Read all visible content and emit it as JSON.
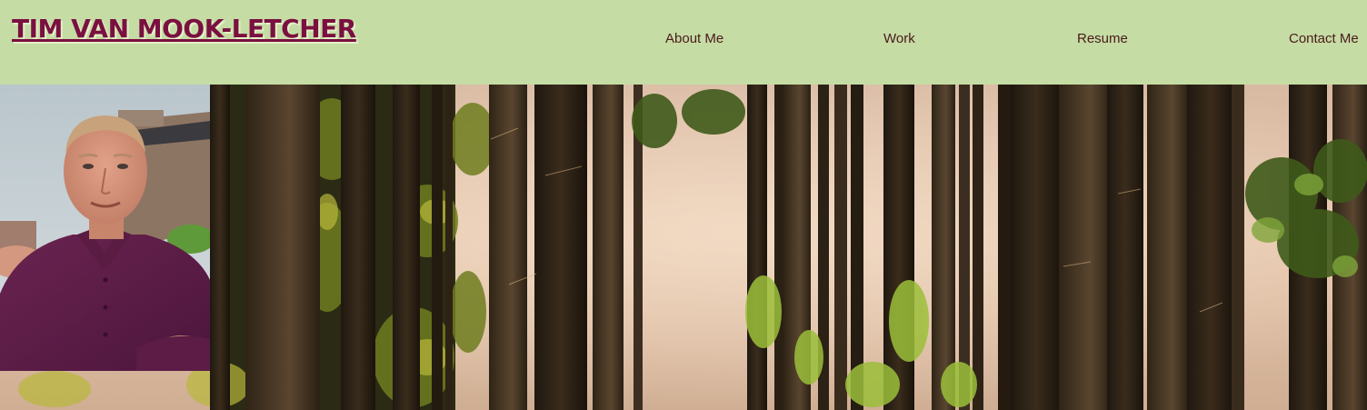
{
  "header": {
    "site_title": "TIM VAN MOOK-LETCHER",
    "nav": [
      {
        "label": "About Me"
      },
      {
        "label": "Work"
      },
      {
        "label": "Resume"
      },
      {
        "label": "Contact Me"
      }
    ]
  },
  "hero": {
    "image": "forest-trees-photo"
  },
  "portrait": {
    "image": "profile-photo"
  },
  "colors": {
    "header_bg": "#c5dca5",
    "title": "#7a1040",
    "nav_text": "#4a1a1a"
  }
}
